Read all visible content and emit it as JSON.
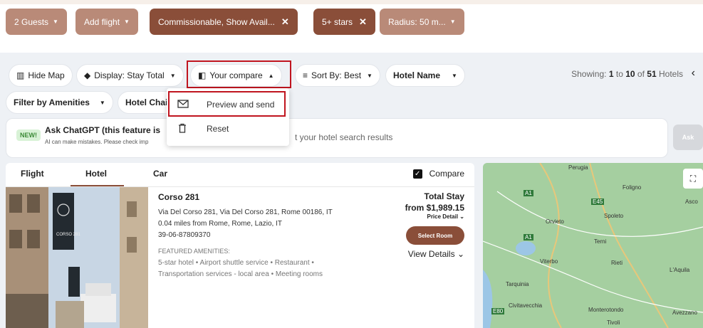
{
  "filters": {
    "guests": "2 Guests",
    "add_flight": "Add flight",
    "commissionable": "Commissionable, Show Avail...",
    "stars": "5+ stars",
    "radius": "Radius: 50 m..."
  },
  "toolbar": {
    "hide_map": "Hide Map",
    "display": "Display: Stay Total",
    "your_compare": "Your compare",
    "sort_by": "Sort By: Best",
    "hotel_name": "Hotel Name",
    "filter_amenities": "Filter by Amenities",
    "hotel_chain": "Hotel Chai"
  },
  "showing": {
    "prefix": "Showing:",
    "from": "1",
    "to_word": "to",
    "to": "10",
    "of_word": "of",
    "total": "51",
    "suffix": "Hotels"
  },
  "compare_menu": {
    "preview_send": "Preview and send",
    "reset": "Reset"
  },
  "chatgpt": {
    "badge": "NEW!",
    "title": "Ask ChatGPT (this feature is",
    "note": "AI can make mistakes. Please check imp",
    "input_text": "t your hotel search results",
    "ask_button": "Ask"
  },
  "result_tabs": {
    "flight": "Flight",
    "hotel": "Hotel",
    "car": "Car",
    "compare": "Compare"
  },
  "hotel": {
    "name": "Corso 281",
    "address": "Via Del Corso 281, Via Del Corso 281, Rome 00186, IT",
    "distance": "0.04 miles from Rome, Rome, Lazio, IT",
    "phone": "39-06-87809370",
    "amenities_label": "FEATURED AMENITIES:",
    "amenities_line1": "5-star hotel • Airport shuttle service • Restaurant •",
    "amenities_line2": "Transportation services - local area • Meeting rooms",
    "total_label": "Total Stay",
    "price": "from $1,989.15",
    "price_detail": "Price Detail",
    "select_room": "Select Room",
    "view_details": "View Details",
    "banner_text": "CORSO 281"
  },
  "map": {
    "labels": [
      "Perugia",
      "Foligno",
      "Orvieto",
      "Spoleto",
      "Terni",
      "Viterbo",
      "Rieti",
      "L'Aquila",
      "Tarquinia",
      "Civitavecchia",
      "Monterotondo",
      "Tivoli",
      "Avezzano",
      "Asco"
    ],
    "road_labels": [
      "A1",
      "A1",
      "E45",
      "E80"
    ]
  },
  "colors": {
    "chip_light": "#b98a78",
    "chip_dark": "#8a4e39",
    "highlight": "#c0151f",
    "background": "#eef1f5"
  }
}
